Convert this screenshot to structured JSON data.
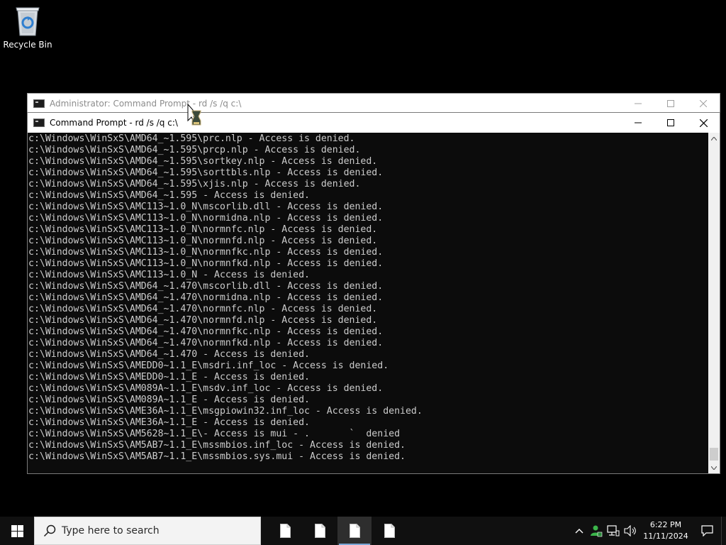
{
  "desktop": {
    "icons": [
      {
        "label": "Recycle Bin",
        "icon": "recycle-bin-icon"
      }
    ]
  },
  "back_window": {
    "title": "Administrator: Command Prompt - rd  /s /q c:\\",
    "state": "inactive"
  },
  "front_window": {
    "title": "Command Prompt - rd  /s /q c:\\",
    "state": "active",
    "console_lines": [
      "c:\\Windows\\WinSxS\\AMD64_~1.595\\prc.nlp - Access is denied.",
      "c:\\Windows\\WinSxS\\AMD64_~1.595\\prcp.nlp - Access is denied.",
      "c:\\Windows\\WinSxS\\AMD64_~1.595\\sortkey.nlp - Access is denied.",
      "c:\\Windows\\WinSxS\\AMD64_~1.595\\sorttbls.nlp - Access is denied.",
      "c:\\Windows\\WinSxS\\AMD64_~1.595\\xjis.nlp - Access is denied.",
      "c:\\Windows\\WinSxS\\AMD64_~1.595 - Access is denied.",
      "c:\\Windows\\WinSxS\\AMC113~1.0_N\\mscorlib.dll - Access is denied.",
      "c:\\Windows\\WinSxS\\AMC113~1.0_N\\normidna.nlp - Access is denied.",
      "c:\\Windows\\WinSxS\\AMC113~1.0_N\\normnfc.nlp - Access is denied.",
      "c:\\Windows\\WinSxS\\AMC113~1.0_N\\normnfd.nlp - Access is denied.",
      "c:\\Windows\\WinSxS\\AMC113~1.0_N\\normnfkc.nlp - Access is denied.",
      "c:\\Windows\\WinSxS\\AMC113~1.0_N\\normnfkd.nlp - Access is denied.",
      "c:\\Windows\\WinSxS\\AMC113~1.0_N - Access is denied.",
      "c:\\Windows\\WinSxS\\AMD64_~1.470\\mscorlib.dll - Access is denied.",
      "c:\\Windows\\WinSxS\\AMD64_~1.470\\normidna.nlp - Access is denied.",
      "c:\\Windows\\WinSxS\\AMD64_~1.470\\normnfc.nlp - Access is denied.",
      "c:\\Windows\\WinSxS\\AMD64_~1.470\\normnfd.nlp - Access is denied.",
      "c:\\Windows\\WinSxS\\AMD64_~1.470\\normnfkc.nlp - Access is denied.",
      "c:\\Windows\\WinSxS\\AMD64_~1.470\\normnfkd.nlp - Access is denied.",
      "c:\\Windows\\WinSxS\\AMD64_~1.470 - Access is denied.",
      "c:\\Windows\\WinSxS\\AMEDD0~1.1_E\\msdri.inf_loc - Access is denied.",
      "c:\\Windows\\WinSxS\\AMEDD0~1.1_E - Access is denied.",
      "c:\\Windows\\WinSxS\\AM089A~1.1_E\\msdv.inf_loc - Access is denied.",
      "c:\\Windows\\WinSxS\\AM089A~1.1_E - Access is denied.",
      "c:\\Windows\\WinSxS\\AME36A~1.1_E\\msgpiowin32.inf_loc - Access is denied.",
      "c:\\Windows\\WinSxS\\AME36A~1.1_E - Access is denied.",
      "c:\\Windows\\WinSxS\\AM5628~1.1_E\\- Access is mui - .       `  denied",
      "c:\\Windows\\WinSxS\\AM5AB7~1.1_E\\mssmbios.inf_loc - Access is denied.",
      "c:\\Windows\\WinSxS\\AM5AB7~1.1_E\\mssmbios.sys.mui - Access is denied."
    ]
  },
  "taskbar": {
    "search_placeholder": "Type here to search",
    "task_items": [
      {
        "icon": "document-icon",
        "active": false
      },
      {
        "icon": "document-icon",
        "active": false
      },
      {
        "icon": "document-icon",
        "active": true
      },
      {
        "icon": "document-icon",
        "active": false
      }
    ],
    "tray": {
      "icons": [
        "chevron-up-icon",
        "user-network-icon",
        "network-icon",
        "volume-icon"
      ],
      "time": "6:22 PM",
      "date": "11/11/2024"
    }
  },
  "colors": {
    "console_bg": "#0c0c0c",
    "console_text": "#cccccc",
    "taskbar_bg": "#101010",
    "active_indicator": "#7aa7d6"
  }
}
